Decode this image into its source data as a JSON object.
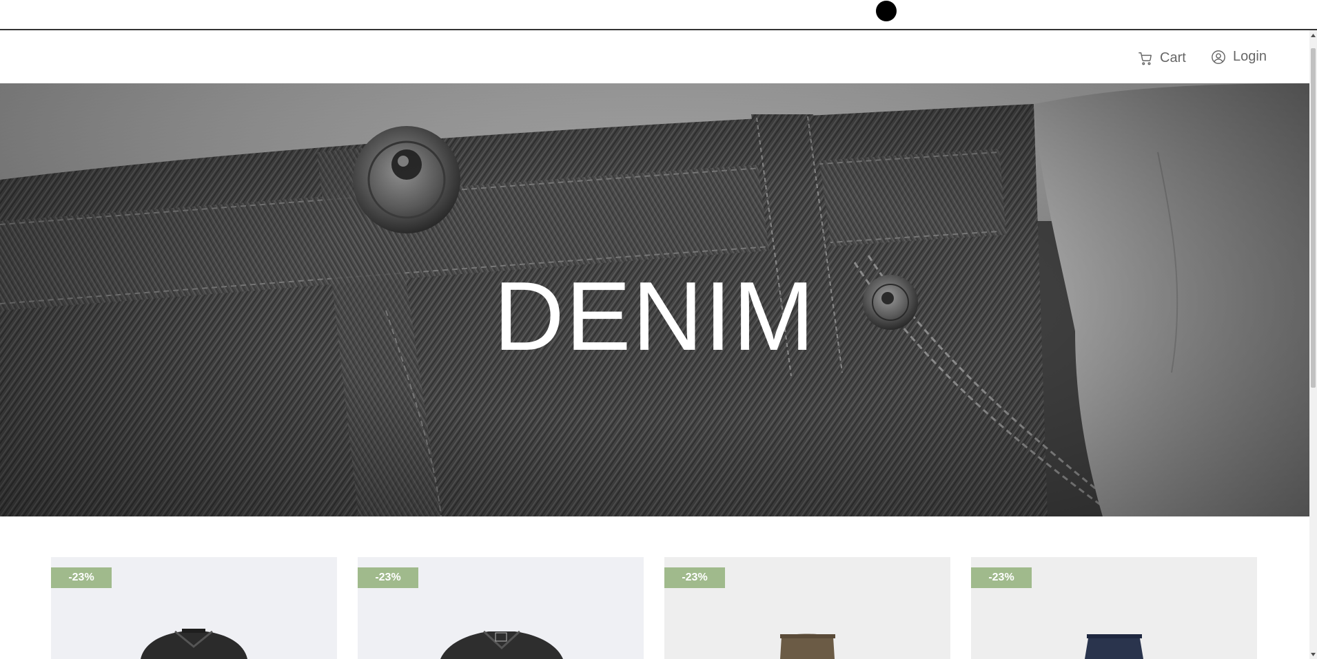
{
  "nav": {
    "cart_label": "Cart",
    "login_label": "Login",
    "cart_icon": "cart-icon",
    "login_icon": "user-circle-icon"
  },
  "hero": {
    "title": "DENIM"
  },
  "products": [
    {
      "discount": "-23%",
      "bg": "#eff0f4",
      "item_color": "#2b2b2b"
    },
    {
      "discount": "-23%",
      "bg": "#eff0f4",
      "item_color": "#2e2e2e"
    },
    {
      "discount": "-23%",
      "bg": "#eeeeee",
      "item_color": "#6b5b45"
    },
    {
      "discount": "-23%",
      "bg": "#eeeeee",
      "item_color": "#2a344d"
    }
  ],
  "colors": {
    "badge": "#a0ba8c",
    "nav_text": "#666666",
    "hero_title": "#ffffff"
  }
}
